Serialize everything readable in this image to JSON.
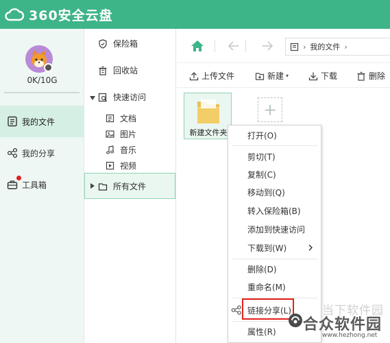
{
  "app": {
    "title": "360安全云盘"
  },
  "account": {
    "quota": "0K/10G"
  },
  "sidebar": {
    "items": [
      {
        "label": "我的文件",
        "icon": "file-list-icon",
        "active": true
      },
      {
        "label": "我的分享",
        "icon": "share-icon",
        "active": false
      },
      {
        "label": "工具箱",
        "icon": "toolbox-icon",
        "active": false,
        "has_badge": true
      }
    ]
  },
  "tree": {
    "safe_box": "保险箱",
    "recycle": "回收站",
    "quick_access": "快速访问",
    "categories": [
      "文档",
      "图片",
      "音乐",
      "视频"
    ],
    "all_files": "所有文件"
  },
  "path": {
    "breadcrumb": "我的文件"
  },
  "toolbar": {
    "upload": "上传文件",
    "new": "新建",
    "download": "下载",
    "delete": "删除"
  },
  "files": [
    {
      "name": "新建文件夹",
      "type": "folder"
    }
  ],
  "context_menu": {
    "items": [
      "打开(O)",
      "剪切(T)",
      "复制(C)",
      "移动到(Q)",
      "转入保险箱(B)",
      "添加到快速访问",
      "下载到(W)",
      "删除(D)",
      "重命名(M)",
      "链接分享(L)",
      "属性(R)"
    ],
    "highlighted": "链接分享(L)"
  },
  "watermark": {
    "line1": "当下软件园",
    "line2": "合众软件园",
    "url": "www.hezhong.net"
  },
  "colors": {
    "brand": "#3eb489",
    "sidebar_bg": "#eef7f3",
    "selected_bg": "#eaf7f0",
    "highlight": "#e0201c"
  }
}
